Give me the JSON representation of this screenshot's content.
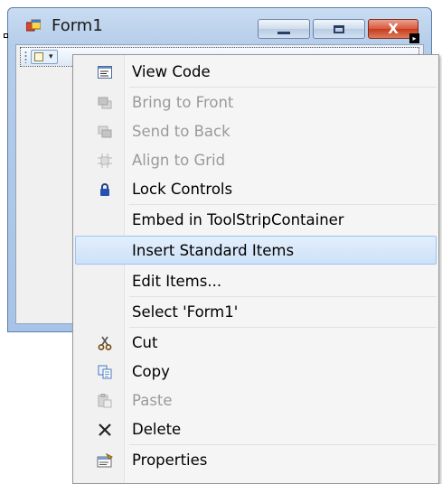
{
  "window": {
    "title": "Form1",
    "caption_buttons": {
      "minimize": "—",
      "maximize": "□",
      "close": "X"
    }
  },
  "toolstrip": {
    "add_item_dropdown": "▾"
  },
  "context_menu": {
    "items": [
      {
        "label": "View Code",
        "icon": "view-code-icon",
        "enabled": true
      },
      {
        "label": "Bring to Front",
        "icon": "bring-to-front-icon",
        "enabled": false
      },
      {
        "label": "Send to Back",
        "icon": "send-to-back-icon",
        "enabled": false
      },
      {
        "label": "Align to Grid",
        "icon": "align-to-grid-icon",
        "enabled": false
      },
      {
        "label": "Lock Controls",
        "icon": "lock-icon",
        "enabled": true
      },
      {
        "label": "Embed in ToolStripContainer",
        "icon": "",
        "enabled": true
      },
      {
        "label": "Insert Standard Items",
        "icon": "",
        "enabled": true,
        "highlighted": true
      },
      {
        "label": "Edit Items...",
        "icon": "",
        "enabled": true
      },
      {
        "label": "Select 'Form1'",
        "icon": "",
        "enabled": true
      },
      {
        "label": "Cut",
        "icon": "scissors-icon",
        "enabled": true
      },
      {
        "label": "Copy",
        "icon": "copy-icon",
        "enabled": true
      },
      {
        "label": "Paste",
        "icon": "paste-icon",
        "enabled": false
      },
      {
        "label": "Delete",
        "icon": "delete-icon",
        "enabled": true
      },
      {
        "label": "Properties",
        "icon": "properties-icon",
        "enabled": true
      }
    ]
  },
  "colors": {
    "highlight_border": "#99c4f0",
    "disabled_text": "#9a9a9a",
    "close_button": "#c8391c"
  }
}
